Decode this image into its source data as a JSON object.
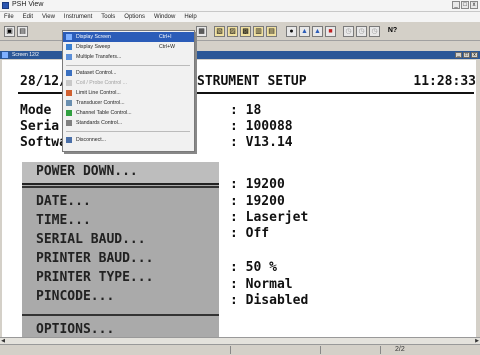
{
  "app": {
    "title": "PSH View"
  },
  "window_buttons": {
    "minimize": "_",
    "maximize": "□",
    "close": "x"
  },
  "menubar": [
    "File",
    "Edit",
    "View",
    "Instrument",
    "Tools",
    "Options",
    "Window",
    "Help"
  ],
  "toolbar": {
    "icons": [
      "save-icon",
      "open-icon",
      "print-icon",
      "copy-icon",
      "chart-icon",
      "table-icon",
      "filter-icon",
      "zoom-icon",
      "help-icon"
    ],
    "help_label": "N?"
  },
  "child_window": {
    "title": "Screen 12/2"
  },
  "screen": {
    "date": "28/12/",
    "title": "STRUMENT SETUP",
    "time": "11:28:33",
    "labels": {
      "model": "Mode",
      "serial": "Seria",
      "software": "Software Version"
    },
    "values": {
      "model": ": 18",
      "serial": ": 100088",
      "software": ": V13.14"
    },
    "setup_values": [
      ": 19200",
      ": 19200",
      ": Laserjet",
      ": Off",
      ": 50 %",
      ": Normal",
      ": Disabled"
    ]
  },
  "softkeys": {
    "power_down": "POWER DOWN...",
    "items": [
      "DATE...",
      "TIME...",
      "SERIAL BAUD...",
      "PRINTER BAUD...",
      "PRINTER TYPE...",
      "PINCODE..."
    ],
    "options": "OPTIONS..."
  },
  "instrument_menu": {
    "items": [
      {
        "label": "Display Screen",
        "shortcut": "Ctrl+I",
        "icon": "monitor-icon",
        "selected": true
      },
      {
        "label": "Display Sweep",
        "shortcut": "Ctrl+W",
        "icon": "sweep-icon"
      },
      {
        "label": "Multiple Transfers...",
        "shortcut": "",
        "icon": "transfer-icon"
      },
      {
        "label": "Dataset Control...",
        "shortcut": "",
        "icon": "dataset-icon"
      },
      {
        "label": "Coil / Probe Control ...",
        "shortcut": "",
        "icon": "coil-icon",
        "disabled": true
      },
      {
        "label": "Limit Line Control...",
        "shortcut": "",
        "icon": "limit-icon"
      },
      {
        "label": "Transducer Control...",
        "shortcut": "",
        "icon": "transducer-icon"
      },
      {
        "label": "Channel Table Control...",
        "shortcut": "",
        "icon": "channel-icon"
      },
      {
        "label": "Standards Control...",
        "shortcut": "",
        "icon": "standards-icon"
      },
      {
        "label": "Disconnect...",
        "shortcut": "",
        "icon": "disconnect-icon"
      }
    ]
  },
  "status": {
    "text": "2/2"
  },
  "colors": {
    "title_bar": "#2b5797",
    "menu_highlight": "#2b5cb8",
    "panel": "#aaaaaa"
  }
}
